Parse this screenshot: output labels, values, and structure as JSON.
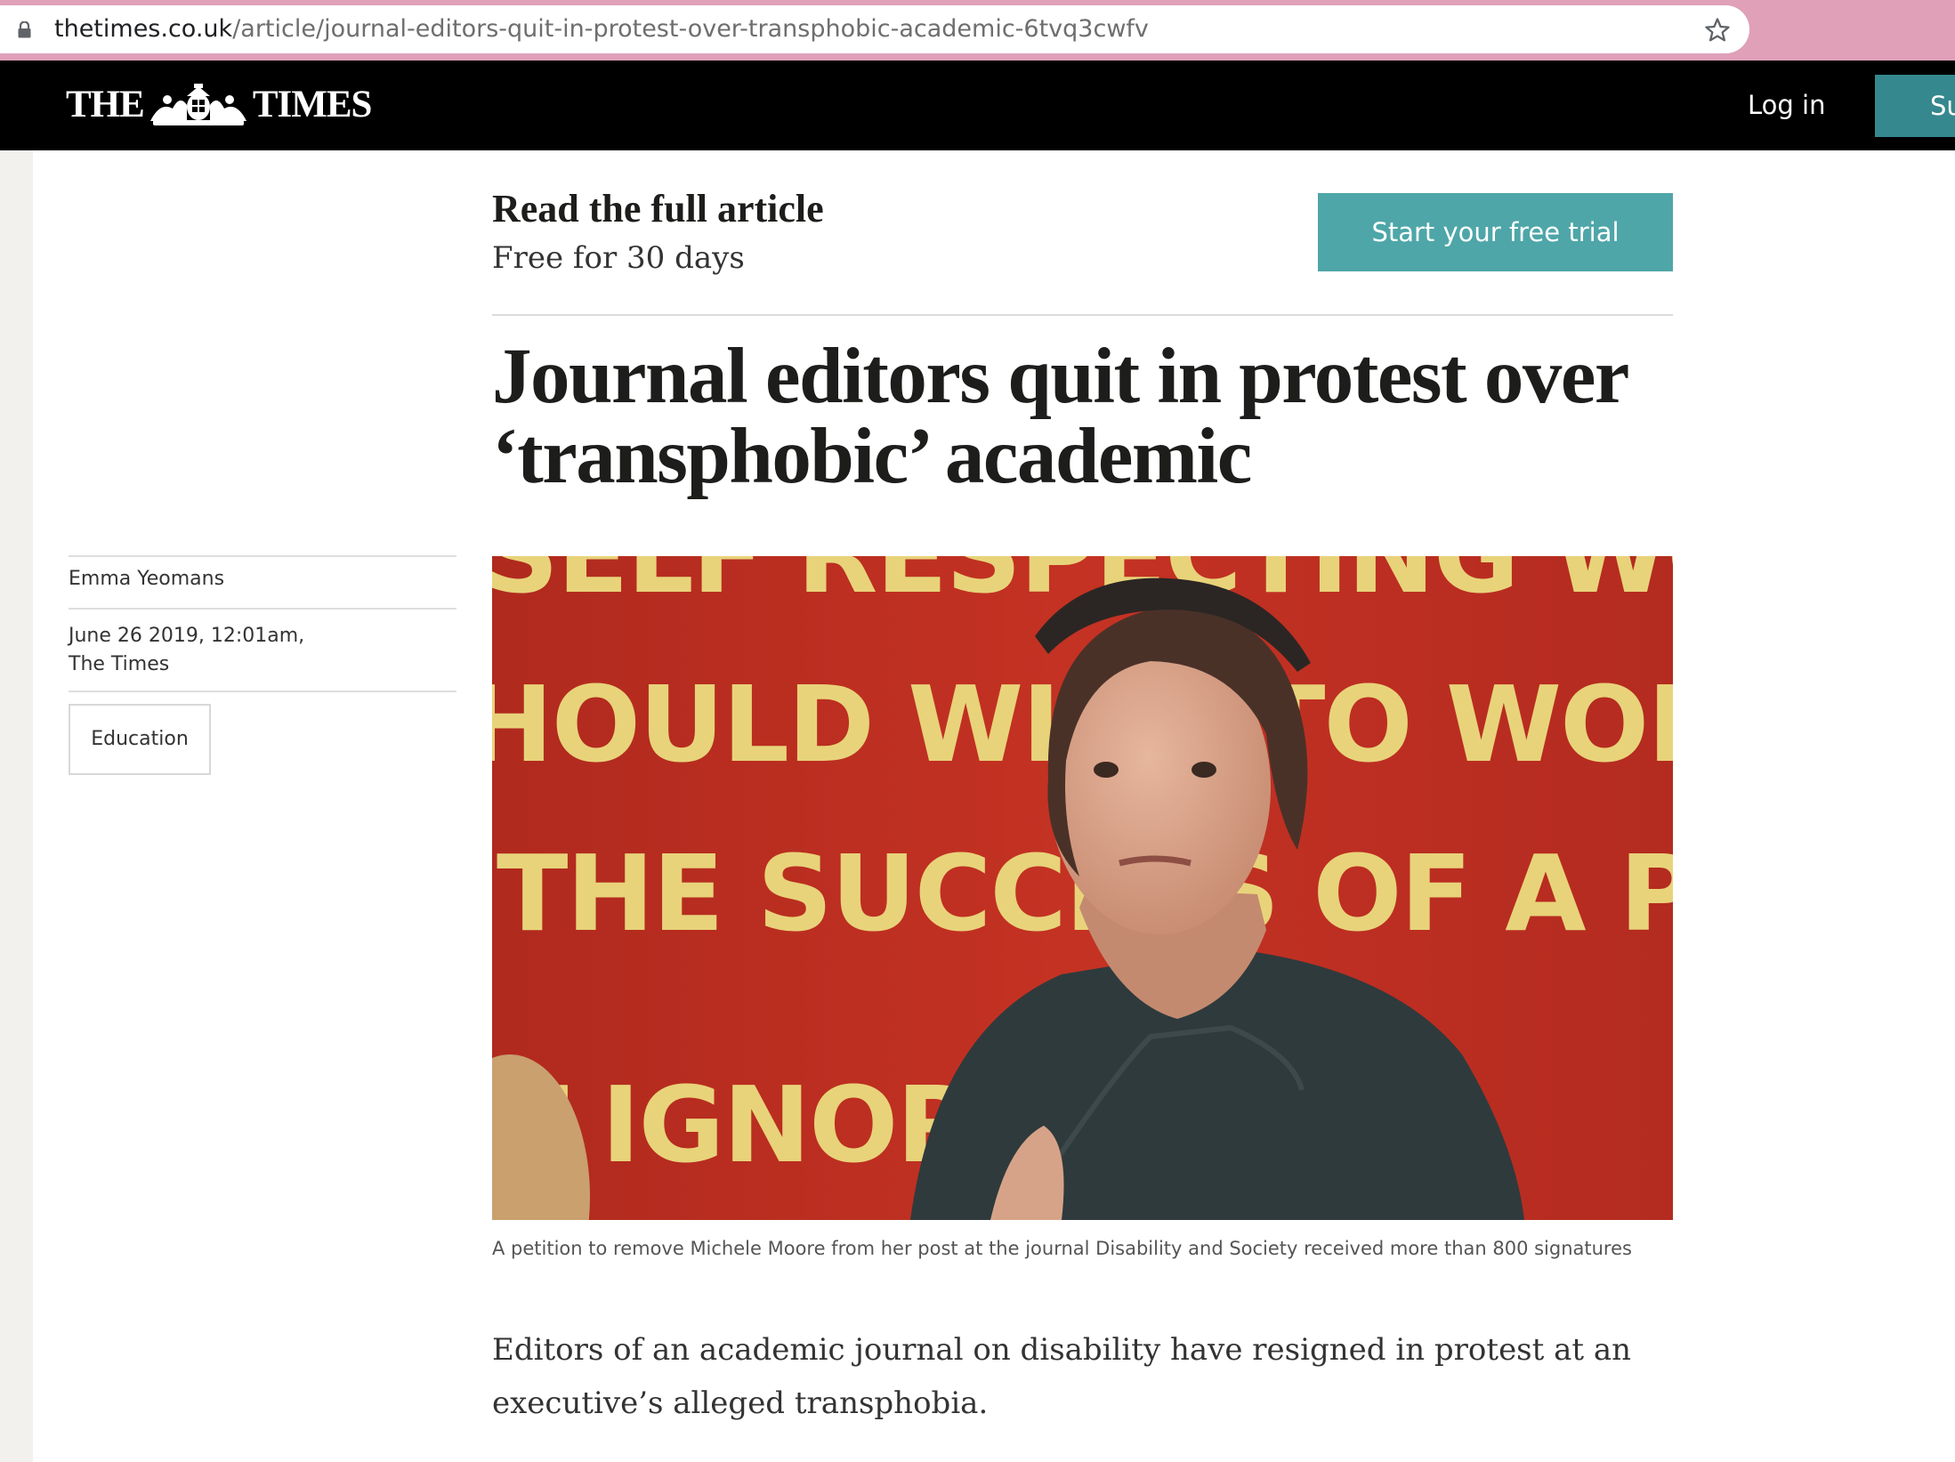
{
  "browser": {
    "url_host": "thetimes.co.uk",
    "url_path": "/article/journal-editors-quit-in-protest-over-transphobic-academic-6tvq3cwfv"
  },
  "masthead": {
    "logo_left": "THE",
    "logo_right": "TIMES",
    "login_label": "Log in",
    "subscribe_label": "Su"
  },
  "promo": {
    "title": "Read the full article",
    "subtitle": "Free for 30 days",
    "cta_label": "Start your free trial"
  },
  "article": {
    "headline": "Journal editors quit in protest over ‘transphobic’ academic",
    "author": "Emma Yeomans",
    "date": "June 26 2019, 12:01am,",
    "publication": "The Times",
    "topic_label": "Education",
    "photo_banner_lines": [
      "SELF RESPECTING WOM",
      "HOULD WISH TO WORK",
      "THE SUCCESS OF A PAR",
      "T IGNORE"
    ],
    "caption": "A petition to remove Michele Moore from her post at the journal Disability and Society received more than 800 signatures",
    "intro": "Editors of an academic journal on disability have resigned in protest at an executive’s alleged transphobia."
  },
  "colors": {
    "chrome": "#dfa0b8",
    "masthead": "#000000",
    "accent_teal": "#4ea6a8",
    "banner_red": "#b52a1f",
    "banner_text": "#e8d37a"
  }
}
